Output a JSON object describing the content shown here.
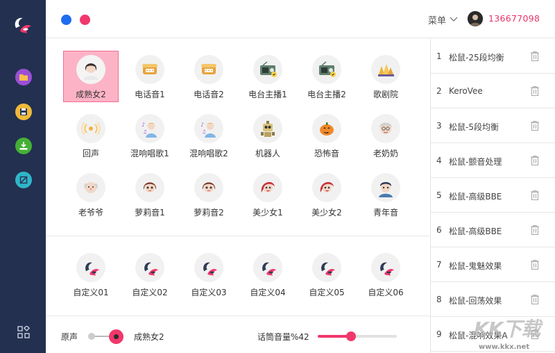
{
  "header": {
    "menu_label": "菜单",
    "phone": "136677098"
  },
  "colors": {
    "sidebar": "#233050",
    "accent": "#f1386c",
    "blue_dot": "#1f6cf0",
    "selected_bg": "#fdb3c6"
  },
  "sidebar": {
    "buttons": [
      {
        "icon": "folder-icon",
        "color": "#9b4fd6"
      },
      {
        "icon": "save-icon",
        "color": "#f0b93a"
      },
      {
        "icon": "download-icon",
        "color": "#45b035"
      },
      {
        "icon": "block-icon",
        "color": "#2fb6c9"
      }
    ],
    "bottom_icon": "apps-grid-icon"
  },
  "voices": [
    {
      "name": "成熟女2",
      "icon": "woman-icon",
      "selected": true
    },
    {
      "name": "电话音1",
      "icon": "telephone-icon"
    },
    {
      "name": "电话音2",
      "icon": "telephone-icon"
    },
    {
      "name": "电台主播1",
      "icon": "radio-icon"
    },
    {
      "name": "电台主播2",
      "icon": "radio-icon"
    },
    {
      "name": "歌剧院",
      "icon": "opera-house-icon"
    },
    {
      "name": "回声",
      "icon": "echo-icon"
    },
    {
      "name": "混响唱歌1",
      "icon": "singer-icon"
    },
    {
      "name": "混响唱歌2",
      "icon": "singer-icon"
    },
    {
      "name": "机器人",
      "icon": "robot-icon"
    },
    {
      "name": "恐怖音",
      "icon": "pumpkin-icon"
    },
    {
      "name": "老奶奶",
      "icon": "grandma-icon"
    },
    {
      "name": "老爷爷",
      "icon": "grandpa-icon"
    },
    {
      "name": "萝莉音1",
      "icon": "girl-icon"
    },
    {
      "name": "萝莉音2",
      "icon": "girl-icon"
    },
    {
      "name": "美少女1",
      "icon": "beauty-icon"
    },
    {
      "name": "美少女2",
      "icon": "beauty-icon"
    },
    {
      "name": "青年音",
      "icon": "young-man-icon"
    }
  ],
  "custom": [
    {
      "name": "自定义01",
      "icon": "brand-logo-icon"
    },
    {
      "name": "自定义02",
      "icon": "brand-logo-icon"
    },
    {
      "name": "自定义03",
      "icon": "brand-logo-icon"
    },
    {
      "name": "自定义04",
      "icon": "brand-logo-icon"
    },
    {
      "name": "自定义05",
      "icon": "brand-logo-icon"
    },
    {
      "name": "自定义06",
      "icon": "brand-logo-icon"
    }
  ],
  "bottom": {
    "original_label": "原声",
    "current_voice": "成熟女2",
    "mic_volume_label": "话筒音量%42",
    "mic_volume": 0.42
  },
  "presets": [
    {
      "index": "1",
      "label": "松鼠-25段均衡"
    },
    {
      "index": "2",
      "label": "KeroVee"
    },
    {
      "index": "3",
      "label": "松鼠-5段均衡"
    },
    {
      "index": "4",
      "label": "松鼠-颤音处理"
    },
    {
      "index": "5",
      "label": "松鼠-高级BBE"
    },
    {
      "index": "6",
      "label": "松鼠-高级BBE"
    },
    {
      "index": "7",
      "label": "松鼠-鬼魅效果"
    },
    {
      "index": "8",
      "label": "松鼠-回荡效果"
    },
    {
      "index": "9",
      "label": "松鼠-混响效果A"
    }
  ],
  "watermark": {
    "text": "KK下载",
    "url": "www.kkx.net"
  }
}
